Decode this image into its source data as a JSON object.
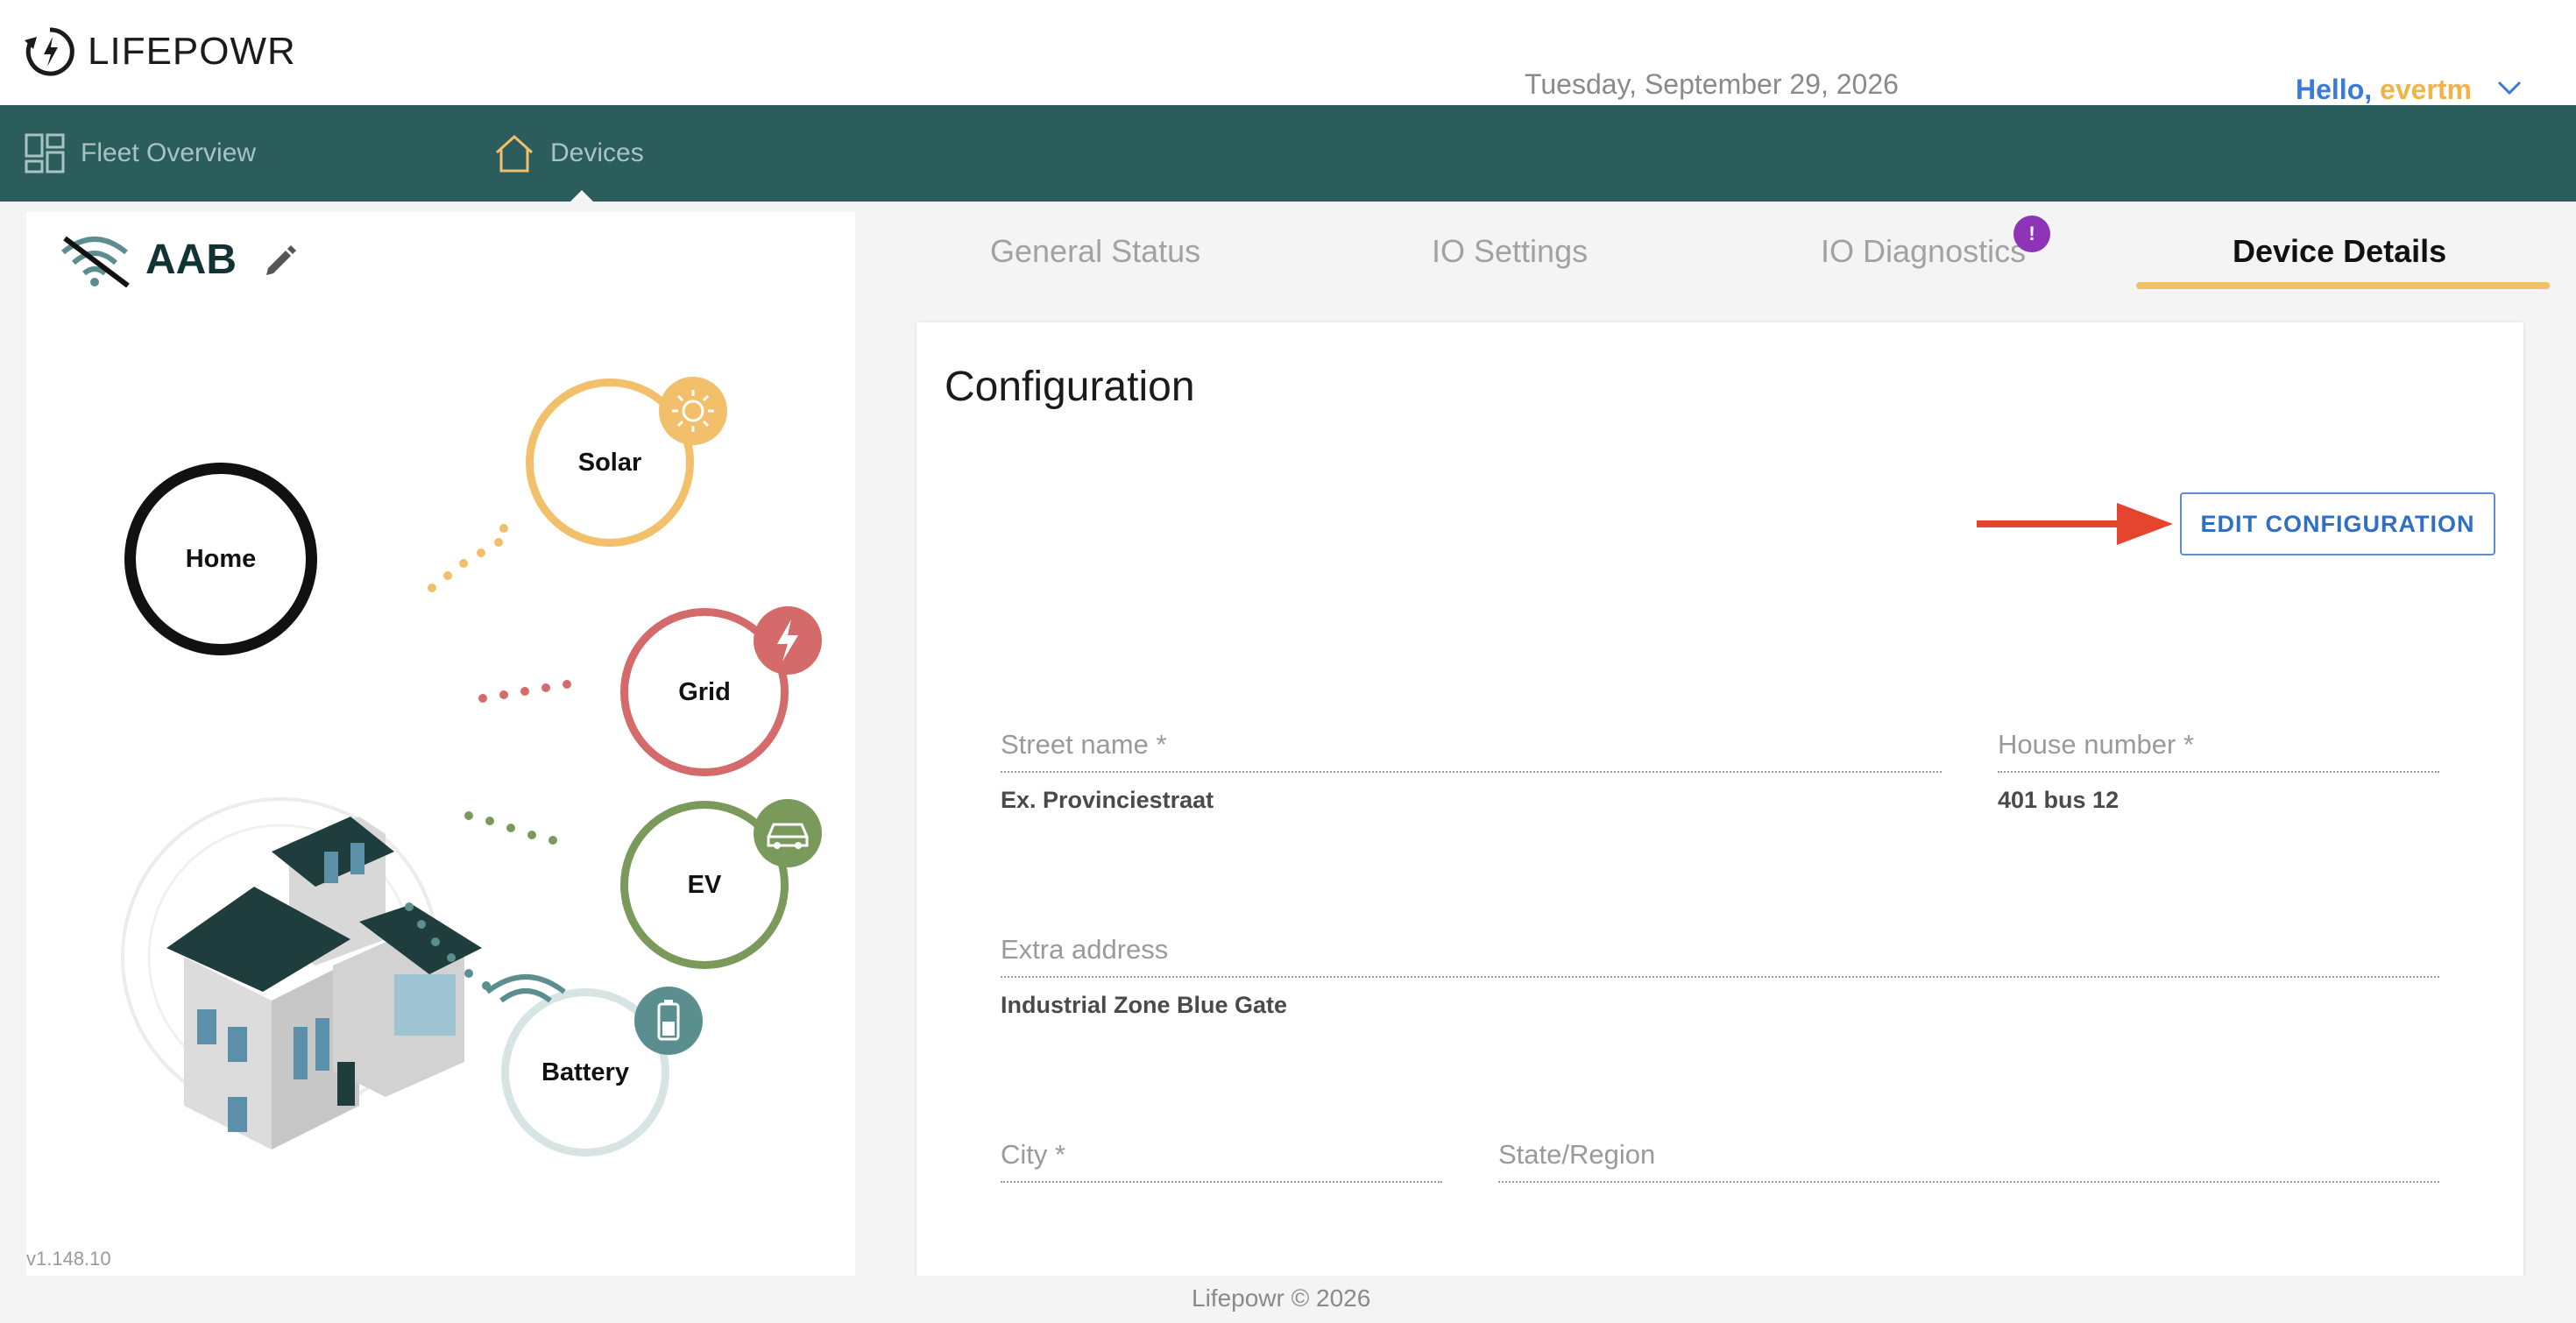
{
  "app": {
    "logo_text": "LIFEPOWR",
    "date": "Tuesday, September 29, 2026",
    "greeting": "Hello,",
    "username": "evertm"
  },
  "nav": {
    "items": [
      {
        "label": "Fleet Overview",
        "icon": "grid-icon"
      },
      {
        "label": "Devices",
        "icon": "home-icon"
      }
    ]
  },
  "device": {
    "name": "AAB",
    "status_icon": "wifi-off-icon",
    "version": "v1.148.10",
    "nodes": {
      "home": "Home",
      "solar": "Solar",
      "grid": "Grid",
      "ev": "EV",
      "battery": "Battery"
    }
  },
  "tabs": [
    {
      "label": "General Status"
    },
    {
      "label": "IO Settings"
    },
    {
      "label": "IO Diagnostics",
      "badge": "!"
    },
    {
      "label": "Device Details",
      "active": true
    }
  ],
  "config": {
    "title": "Configuration",
    "edit_button": "EDIT CONFIGURATION",
    "fields": {
      "street": {
        "label": "Street name *",
        "value": "Ex. Provinciestraat"
      },
      "house": {
        "label": "House number *",
        "value": "401 bus 12"
      },
      "extra": {
        "label": "Extra address",
        "value": "Industrial Zone Blue Gate"
      },
      "city": {
        "label": "City *",
        "value": ""
      },
      "state": {
        "label": "State/Region",
        "value": ""
      }
    }
  },
  "footer": {
    "text": "Lifepowr © 2026"
  },
  "colors": {
    "navbar": "#2b5d5d",
    "accent": "#f2c06a",
    "solar": "#f2c06a",
    "grid": "#d46a6a",
    "ev": "#7a9a5c",
    "battery": "#5b8f8f",
    "link": "#2f6fc4"
  }
}
